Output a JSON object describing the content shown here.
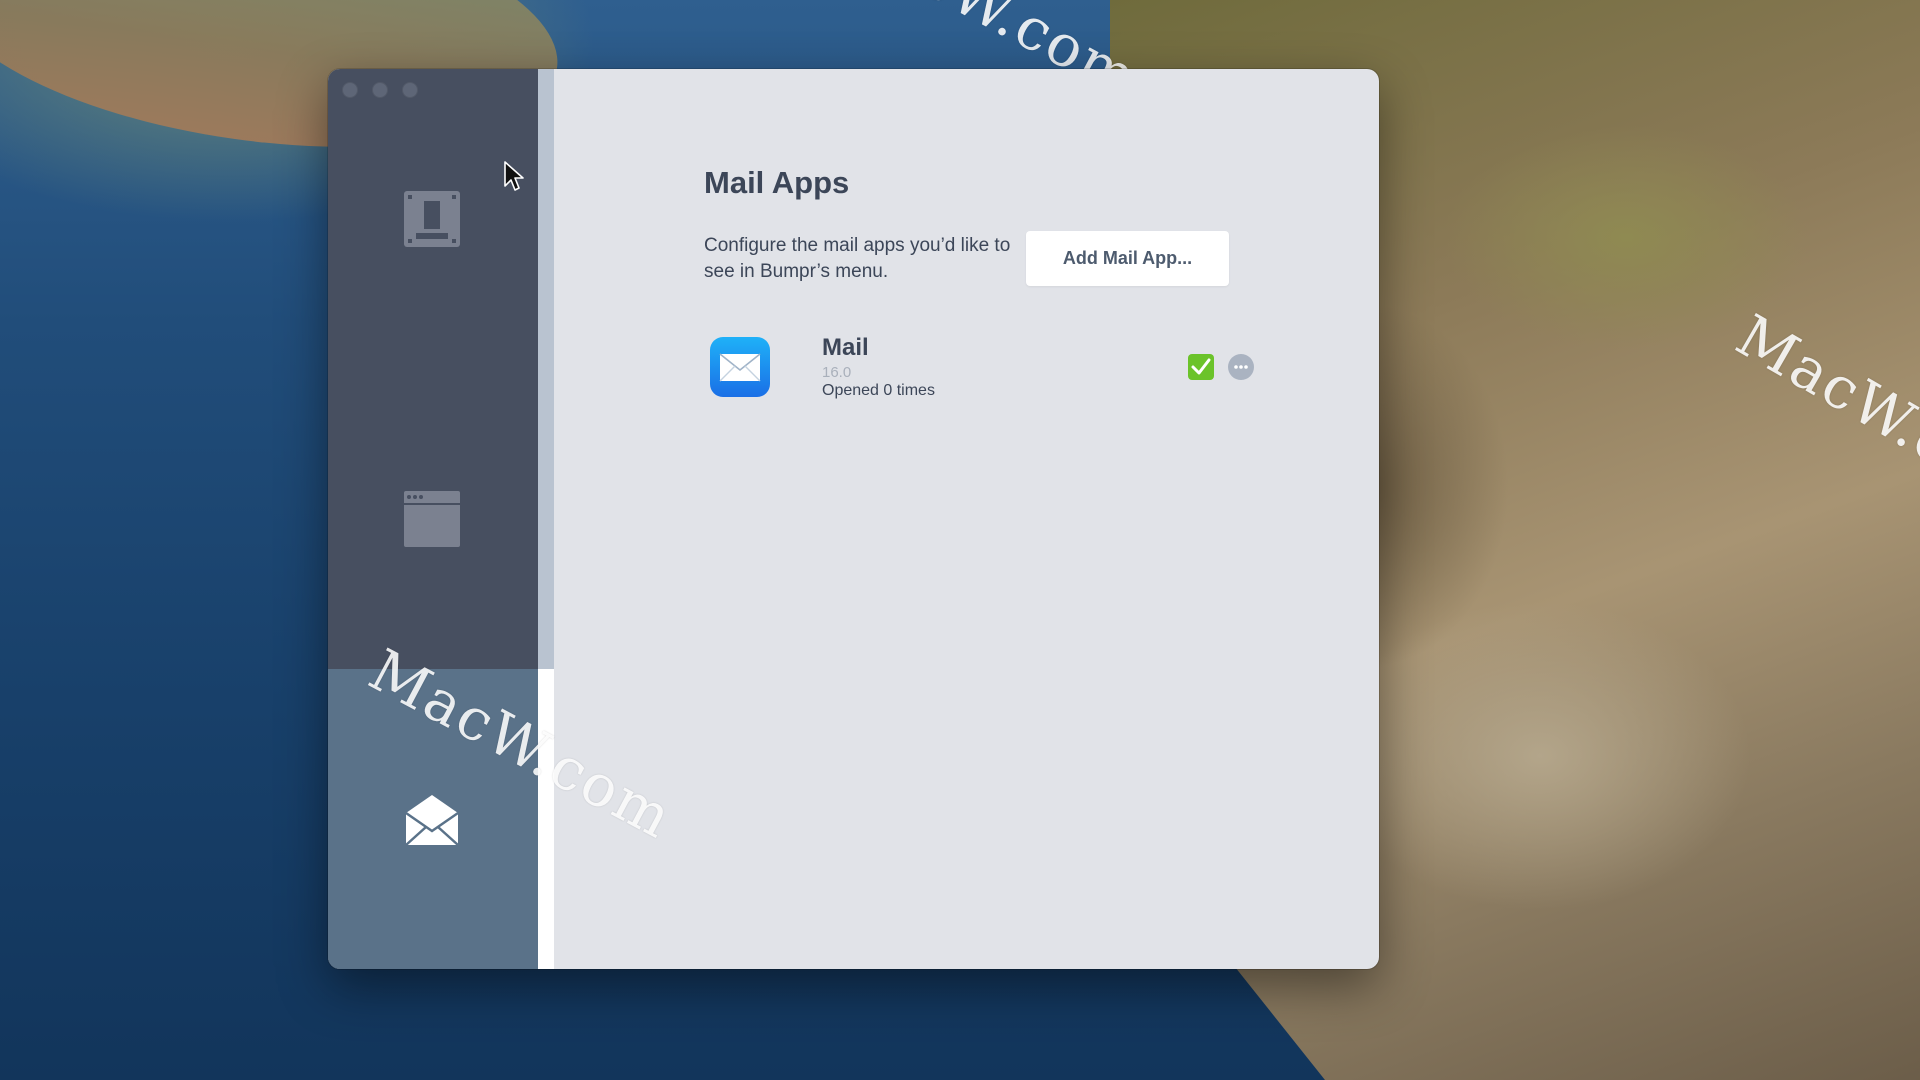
{
  "desktop": {
    "watermark_text": "MacW.com"
  },
  "window": {
    "sidebar": {
      "items": [
        {
          "icon": "browser-icon",
          "selected": false
        },
        {
          "icon": "window-icon",
          "selected": false
        },
        {
          "icon": "envelope-icon",
          "selected": true
        }
      ]
    },
    "content": {
      "title": "Mail Apps",
      "description": "Configure the mail apps you’d like to see in Bumpr’s menu.",
      "add_button_label": "Add Mail App..."
    },
    "apps": [
      {
        "name": "Mail",
        "version": "16.0",
        "opened": "Opened 0 times",
        "icon": "mail-app-icon",
        "enabled": true
      }
    ]
  },
  "colors": {
    "sidebar": "#474f60",
    "sidebar_selected": "#5a7289",
    "content_bg": "#e1e3e8",
    "text": "#3c4658",
    "check_green": "#6bc32a"
  }
}
